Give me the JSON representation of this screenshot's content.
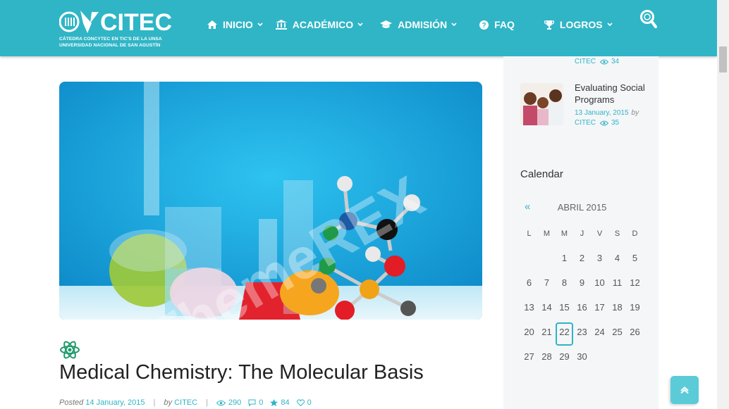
{
  "brand": {
    "name": "CITEC",
    "subtitle_line1": "CÁTEDRA CONCYTEC EN TIC'S DE LA UNSA",
    "subtitle_line2": "UNIVERSIDAD NACIONAL DE SAN AGUSTÍN",
    "accent_color": "#2fb5c6"
  },
  "nav": {
    "items": [
      {
        "label": "INICIO",
        "icon": "home-icon",
        "has_dropdown": true
      },
      {
        "label": "ACADÉMICO",
        "icon": "bank-icon",
        "has_dropdown": true
      },
      {
        "label": "ADMISIÓN",
        "icon": "graduation-cap-icon",
        "has_dropdown": true
      },
      {
        "label": "FAQ",
        "icon": "question-circle-icon",
        "has_dropdown": false
      },
      {
        "label": "LOGROS",
        "icon": "trophy-icon",
        "has_dropdown": true
      }
    ],
    "search_icon": "search-icon"
  },
  "post": {
    "image_watermark": "ThemeREX",
    "category_icon": "atom-icon",
    "title": "Medical Chemistry: The Molecular Basis",
    "posted_label": "Posted",
    "date": "14 January, 2015",
    "by_label": "by",
    "author": "CITEC",
    "views": "290",
    "comments": "0",
    "rating": "84",
    "likes": "0"
  },
  "sidebar": {
    "recent_tail": {
      "author": "CITEC",
      "views": "34"
    },
    "recent_item": {
      "title": "Evaluating Social Programs",
      "date": "13 January, 2015",
      "by_label": "by",
      "author": "CITEC",
      "views": "35"
    },
    "calendar": {
      "title": "Calendar",
      "prev": "«",
      "month": "ABRIL 2015",
      "weekdays": [
        "L",
        "M",
        "M",
        "J",
        "V",
        "S",
        "D"
      ],
      "weeks": [
        [
          "",
          "",
          "1",
          "2",
          "3",
          "4",
          "5"
        ],
        [
          "6",
          "7",
          "8",
          "9",
          "10",
          "11",
          "12"
        ],
        [
          "13",
          "14",
          "15",
          "16",
          "17",
          "18",
          "19"
        ],
        [
          "20",
          "21",
          "22",
          "23",
          "24",
          "25",
          "26"
        ],
        [
          "27",
          "28",
          "29",
          "30",
          "",
          "",
          ""
        ]
      ],
      "today": "22"
    }
  }
}
